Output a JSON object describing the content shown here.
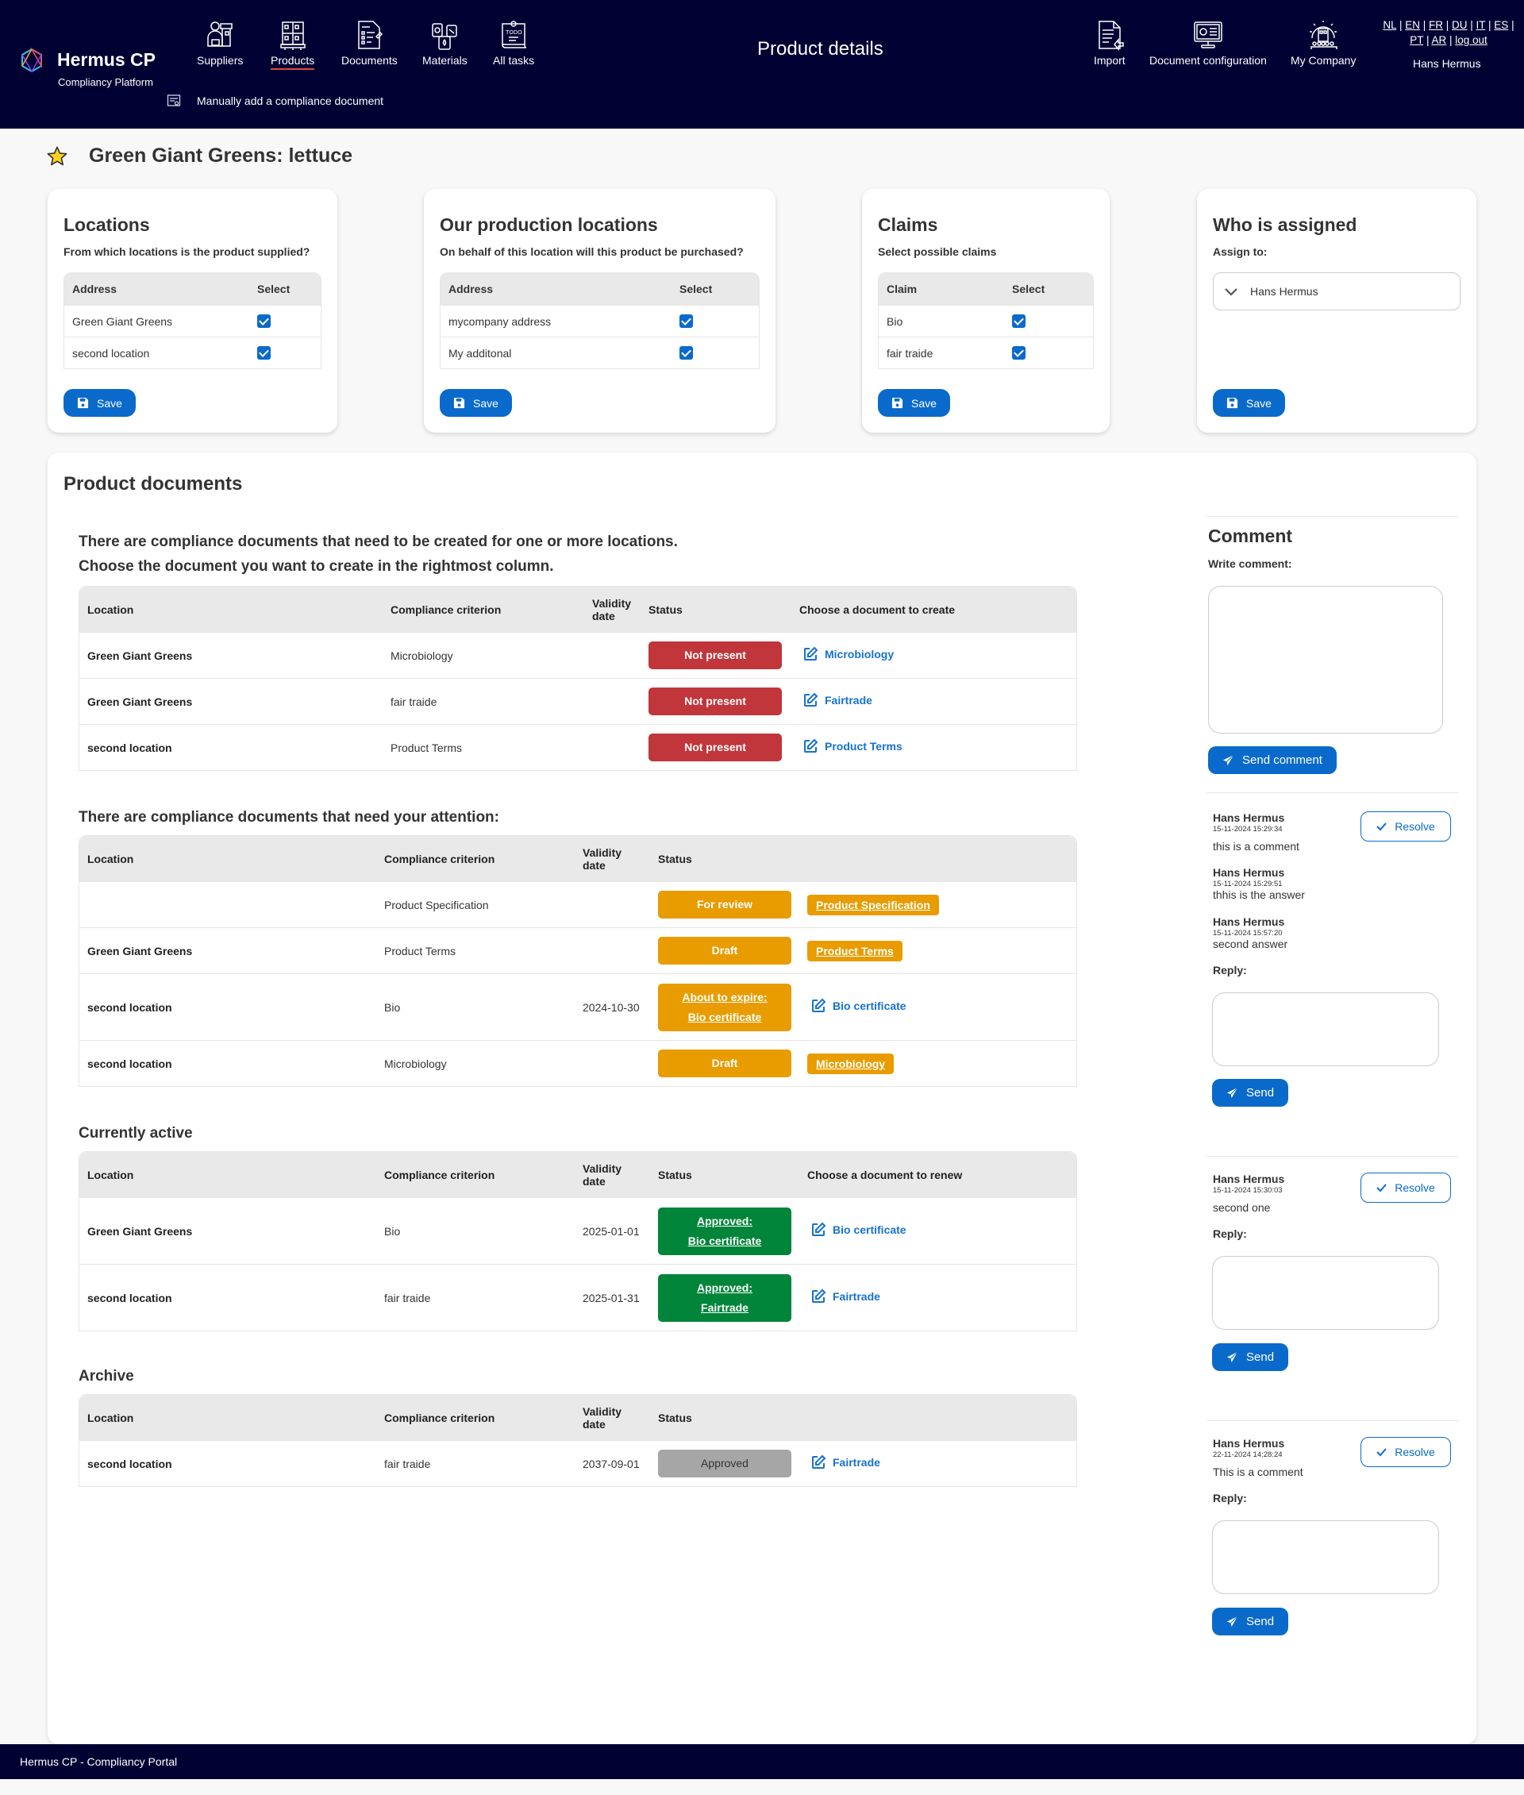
{
  "header": {
    "brand": "Hermus CP",
    "brand_sub": "Compliancy Platform",
    "nav": [
      {
        "label": "Suppliers",
        "icon": "supplier-icon"
      },
      {
        "label": "Products",
        "icon": "pallet-boxes-icon",
        "active": true
      },
      {
        "label": "Documents",
        "icon": "document-list-icon"
      },
      {
        "label": "Materials",
        "icon": "materials-icon"
      },
      {
        "label": "All tasks",
        "icon": "todo-icon"
      }
    ],
    "sub_action": "Manually add a compliance document",
    "page_title": "Product details",
    "right_nav": [
      {
        "label": "Import",
        "icon": "import-document-icon"
      },
      {
        "label": "Document configuration",
        "icon": "monitor-settings-icon"
      },
      {
        "label": "My Company",
        "icon": "company-gear-icon"
      }
    ],
    "languages": [
      "NL",
      "EN",
      "FR",
      "DU",
      "IT",
      "ES",
      "PT",
      "AR"
    ],
    "logout": "log out",
    "user": "Hans Hermus"
  },
  "product": {
    "title": "Green Giant Greens: lettuce",
    "favorite": true
  },
  "cards": {
    "locations": {
      "title": "Locations",
      "question": "From which locations is the product supplied?",
      "col_address": "Address",
      "col_select": "Select",
      "rows": [
        {
          "name": "Green Giant Greens",
          "checked": true
        },
        {
          "name": "second location",
          "checked": true
        }
      ],
      "save": "Save"
    },
    "production": {
      "title": "Our production locations",
      "question": "On behalf of this location will this product be purchased?",
      "col_address": "Address",
      "col_select": "Select",
      "rows": [
        {
          "name": "mycompany address",
          "checked": true
        },
        {
          "name": "My additonal",
          "checked": true
        }
      ],
      "save": "Save"
    },
    "claims": {
      "title": "Claims",
      "question": "Select possible claims",
      "col_claim": "Claim",
      "col_select": "Select",
      "rows": [
        {
          "name": "Bio",
          "checked": true
        },
        {
          "name": "fair traide",
          "checked": true
        }
      ],
      "save": "Save"
    },
    "assigned": {
      "title": "Who is assigned",
      "label": "Assign to:",
      "selected": "Hans Hermus",
      "save": "Save"
    }
  },
  "documents": {
    "title": "Product documents",
    "columns": {
      "location": "Location",
      "criterion": "Compliance criterion",
      "validity": "Validity date",
      "status": "Status",
      "create": "Choose a document to create",
      "renew": "Choose a document to renew"
    },
    "to_create": {
      "intro_line1": "There are compliance documents that need to be created for one or more locations.",
      "intro_line2": "Choose the document you want to create in the rightmost column.",
      "rows": [
        {
          "location": "Green Giant Greens",
          "criterion": "Microbiology",
          "validity": "",
          "status": "Not present",
          "action": "Microbiology"
        },
        {
          "location": "Green Giant Greens",
          "criterion": "fair traide",
          "validity": "",
          "status": "Not present",
          "action": "Fairtrade"
        },
        {
          "location": "second location",
          "criterion": "Product Terms",
          "validity": "",
          "status": "Not present",
          "action": "Product Terms"
        }
      ]
    },
    "attention": {
      "title": "There are compliance documents that need your attention:",
      "rows": [
        {
          "location": "",
          "criterion": "Product Specification",
          "validity": "",
          "status": "For review",
          "doc": "Product Specification"
        },
        {
          "location": "Green Giant Greens",
          "criterion": "Product Terms",
          "validity": "",
          "status": "Draft",
          "doc": "Product Terms"
        },
        {
          "location": "second location",
          "criterion": "Bio",
          "validity": "2024-10-30",
          "status_line1": "About to expire:",
          "status_line2": "Bio certificate",
          "action": "Bio certificate"
        },
        {
          "location": "second location",
          "criterion": "Microbiology",
          "validity": "",
          "status": "Draft",
          "doc": "Microbiology"
        }
      ]
    },
    "active": {
      "title": "Currently active",
      "rows": [
        {
          "location": "Green Giant Greens",
          "criterion": "Bio",
          "validity": "2025-01-01",
          "status_line1": "Approved:",
          "status_line2": "Bio certificate",
          "action": "Bio certificate"
        },
        {
          "location": "second location",
          "criterion": "fair traide",
          "validity": "2025-01-31",
          "status_line1": "Approved:",
          "status_line2": "Fairtrade",
          "action": "Fairtrade"
        }
      ]
    },
    "archive": {
      "title": "Archive",
      "rows": [
        {
          "location": "second location",
          "criterion": "fair traide",
          "validity": "2037-09-01",
          "status": "Approved",
          "action": "Fairtrade"
        }
      ]
    }
  },
  "comments": {
    "title": "Comment",
    "write_label": "Write comment:",
    "write_value": "",
    "send_comment": "Send comment",
    "reply_label": "Reply:",
    "resolve": "Resolve",
    "send": "Send",
    "threads": [
      {
        "messages": [
          {
            "author": "Hans Hermus",
            "time": "15-11-2024 15:29:34",
            "text": "this is a comment"
          },
          {
            "author": "Hans Hermus",
            "time": "15-11-2024 15:29:51",
            "text": "thhis is the answer"
          },
          {
            "author": "Hans Hermus",
            "time": "15-11-2024 15:57:20",
            "text": "second answer"
          }
        ]
      },
      {
        "messages": [
          {
            "author": "Hans Hermus",
            "time": "15-11-2024 15:30:03",
            "text": "second one"
          }
        ]
      },
      {
        "messages": [
          {
            "author": "Hans Hermus",
            "time": "22-11-2024 14:28:24",
            "text": "This is a comment"
          }
        ]
      }
    ]
  },
  "footer": {
    "text": "Hermus CP - Compliancy Portal"
  },
  "colors": {
    "header_bg": "#000033",
    "primary": "#0a6acb",
    "not_present": "#c0363b",
    "warning": "#e89c00",
    "approved": "#00853a",
    "archived": "#a6a6a6",
    "link": "#1672d0"
  }
}
